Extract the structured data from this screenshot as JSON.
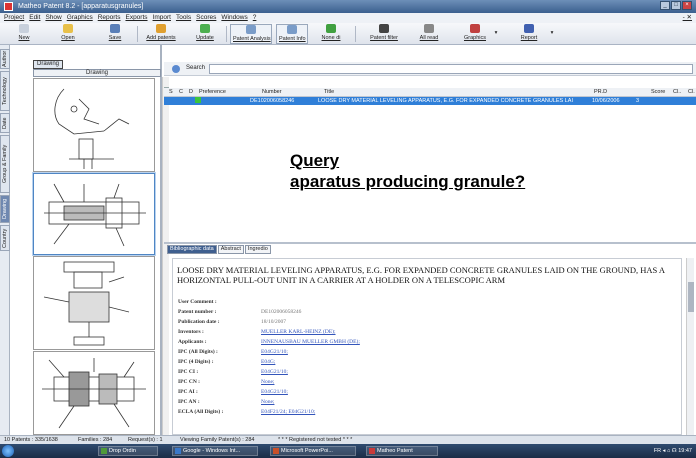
{
  "window": {
    "title": "Matheo Patent 8.2 - [apparatusgranules]"
  },
  "menu": [
    "Project",
    "Edit",
    "Show",
    "Graphics",
    "Reports",
    "Exports",
    "Import",
    "Tools",
    "Scores",
    "Windows",
    "?"
  ],
  "toolbar": [
    {
      "label": "New",
      "color": "#c8d0dc"
    },
    {
      "label": "Open",
      "color": "#e8c04a"
    },
    {
      "label": "Save",
      "color": "#5a7fb8"
    },
    {
      "label": "Add patents",
      "color": "#e0a030"
    },
    {
      "label": "Update",
      "color": "#4caf50"
    },
    {
      "label": "Patent Analysis",
      "color": "#7a9cc8"
    },
    {
      "label": "Patent Info",
      "color": "#7a9cc8"
    },
    {
      "label": "None di",
      "color": "#40a040"
    },
    {
      "label": "Patent filter",
      "color": "#444444"
    },
    {
      "label": "All read",
      "color": "#888888"
    },
    {
      "label": "Graphics",
      "color": "#c04040"
    },
    {
      "label": "Report",
      "color": "#4060b0"
    }
  ],
  "side_tabs": [
    "Author",
    "Technology",
    "Date",
    "Group & Family",
    "Drawing",
    "Country"
  ],
  "drawing": {
    "tab_label": "Drawing",
    "header": "Drawing"
  },
  "search": {
    "label": "Search",
    "value": ""
  },
  "grid": {
    "headers": [
      "S",
      "C",
      "D",
      "Preference",
      "Number",
      "Title",
      "PR.D",
      "Score",
      "Cl..",
      "Cl."
    ],
    "rows": [
      {
        "number": "DE102006058246",
        "title": "LOOSE DRY MATERIAL LEVELING APPARATUS, E.G. FOR EXPANDED CONCRETE GRANULES LAI",
        "prd": "10/06/2006",
        "score": "3"
      }
    ]
  },
  "query_overlay": {
    "line1": "Query",
    "line2": "aparatus producing granule?"
  },
  "detail_tabs": [
    "Bibliographic data",
    "Abstract",
    "Ingredio"
  ],
  "detail": {
    "title": "LOOSE DRY MATERIAL LEVELING APPARATUS, E.G. FOR EXPANDED CONCRETE GRANULES LAID ON THE GROUND, HAS A HORIZONTAL PULL-OUT UNIT IN A CARRIER AT A HOLDER ON A TELESCOPIC ARM",
    "fields": [
      {
        "label": "User Comment :",
        "value": "",
        "link": false
      },
      {
        "label": "Patent number :",
        "value": "DE102006058246",
        "link": false
      },
      {
        "label": "Publication date :",
        "value": "18/10/2007",
        "link": false
      },
      {
        "label": "Inventors :",
        "value": "MUELLER KARL-HEINZ (DE);",
        "link": true
      },
      {
        "label": "Applicants :",
        "value": "INNENAUSBAU MUELLER GMBH (DE);",
        "link": true
      },
      {
        "label": "IPC (All Digits) :",
        "value": "E04G21/10;",
        "link": true
      },
      {
        "label": "IPC (4 Digits) :",
        "value": "E04G;",
        "link": true
      },
      {
        "label": "IPC CI :",
        "value": "E04G21/10;",
        "link": true
      },
      {
        "label": "IPC CN :",
        "value": "None;",
        "link": true
      },
      {
        "label": "IPC AI :",
        "value": "E04G21/10;",
        "link": true
      },
      {
        "label": "IPC AN :",
        "value": "None;",
        "link": true
      },
      {
        "label": "ECLA (All Digits) :",
        "value": "E04F21/24; E04G21/10;",
        "link": true
      }
    ]
  },
  "status": {
    "patents": "10 Patents : 335/1638",
    "families": "Families : 284",
    "requests": "Request(s) : 1",
    "viewing": "Viewing Family Patent(s) : 284",
    "registered": "* * * Registered not tested * * *"
  },
  "taskbar": {
    "tasks": [
      {
        "label": "Drop Ordin",
        "color": "#4f9a3a"
      },
      {
        "label": "Google - Windows Int...",
        "color": "#3a78c8"
      },
      {
        "label": "Microsoft PowerPoi...",
        "color": "#c8502a"
      },
      {
        "label": "Matheo Patent",
        "color": "#c83a3a"
      }
    ],
    "tray": "FR  ◂ ⌂ ☊  19:47"
  }
}
